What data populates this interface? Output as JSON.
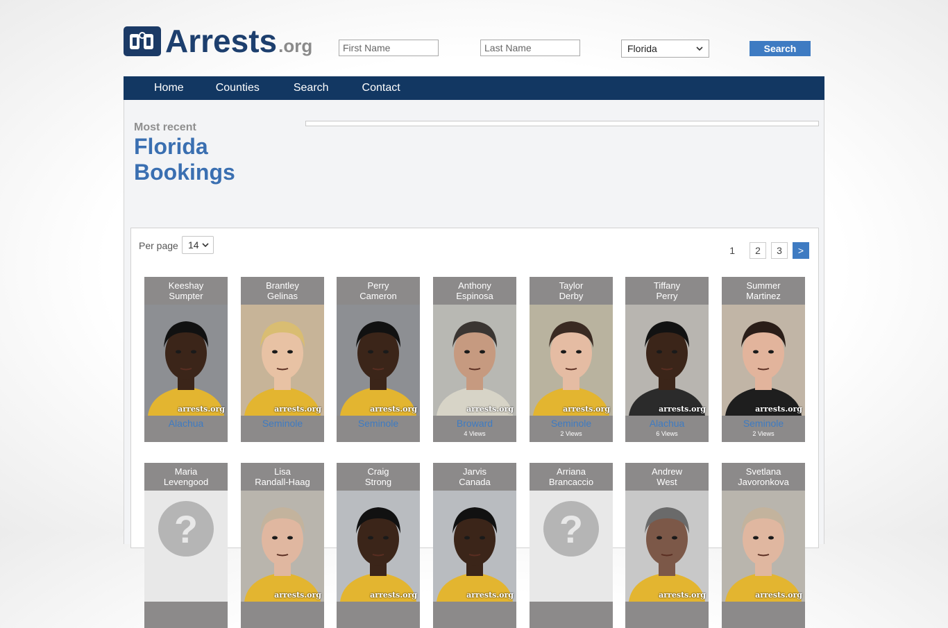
{
  "logo": {
    "main": "Arrests",
    "tld": ".org"
  },
  "search": {
    "first_placeholder": "First Name",
    "last_placeholder": "Last Name",
    "state_value": "Florida",
    "button_label": "Search"
  },
  "nav": [
    "Home",
    "Counties",
    "Search",
    "Contact"
  ],
  "heading": {
    "eyebrow": "Most recent",
    "title": "Florida Bookings"
  },
  "listing": {
    "per_page_label": "Per page",
    "per_page_value": "14",
    "pages": {
      "current": "1",
      "others": [
        "2",
        "3"
      ],
      "next": ">"
    },
    "watermark": "arrests.org"
  },
  "colors": {
    "navy": "#123762",
    "accent": "#3e7bc2",
    "card_bg": "#8c8a8a"
  },
  "cards": [
    {
      "first": "Keeshay",
      "last": "Sumpter",
      "county": "Alachua",
      "views": "",
      "photo": "dark-skin-male-beard"
    },
    {
      "first": "Brantley",
      "last": "Gelinas",
      "county": "Seminole",
      "views": "",
      "photo": "blond-male"
    },
    {
      "first": "Perry",
      "last": "Cameron",
      "county": "Seminole",
      "views": "",
      "photo": "dark-skin-male-beard"
    },
    {
      "first": "Anthony",
      "last": "Espinosa",
      "county": "Broward",
      "views": "4 Views",
      "photo": "grey-beard-male"
    },
    {
      "first": "Taylor",
      "last": "Derby",
      "county": "Seminole",
      "views": "2 Views",
      "photo": "dark-hair-male"
    },
    {
      "first": "Tiffany",
      "last": "Perry",
      "county": "Alachua",
      "views": "6 Views",
      "photo": "dark-skin-female"
    },
    {
      "first": "Summer",
      "last": "Martinez",
      "county": "Seminole",
      "views": "2 Views",
      "photo": "dark-hair-female"
    },
    {
      "first": "Maria",
      "last": "Levengood",
      "county": "",
      "views": "",
      "photo": "placeholder"
    },
    {
      "first": "Lisa",
      "last": "Randall-Haag",
      "county": "",
      "views": "",
      "photo": "grey-hair-female"
    },
    {
      "first": "Craig",
      "last": "Strong",
      "county": "",
      "views": "",
      "photo": "dark-skin-male"
    },
    {
      "first": "Jarvis",
      "last": "Canada",
      "county": "",
      "views": "",
      "photo": "dark-skin-male"
    },
    {
      "first": "Arriana",
      "last": "Brancaccio",
      "county": "",
      "views": "",
      "photo": "placeholder"
    },
    {
      "first": "Andrew",
      "last": "West",
      "county": "",
      "views": "",
      "photo": "grey-hair-male"
    },
    {
      "first": "Svetlana",
      "last": "Javoronkova",
      "county": "",
      "views": "",
      "photo": "grey-hair-female"
    }
  ]
}
